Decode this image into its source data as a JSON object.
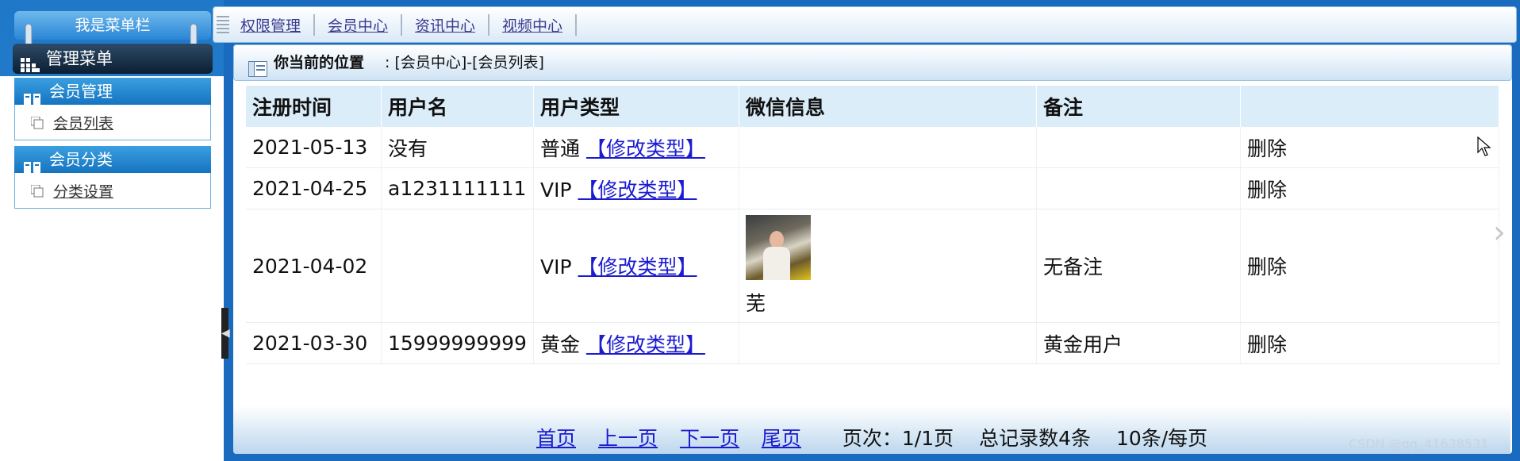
{
  "sidebar": {
    "title": "我是菜单栏",
    "menu_header": "管理菜单",
    "groups": [
      {
        "label": "会员管理",
        "items": [
          {
            "label": "会员列表"
          }
        ]
      },
      {
        "label": "会员分类",
        "items": [
          {
            "label": "分类设置"
          }
        ]
      }
    ]
  },
  "topnav": {
    "links": [
      "权限管理",
      "会员中心",
      "资讯中心",
      "视频中心"
    ]
  },
  "location": {
    "label": "你当前的位置",
    "value": ": [会员中心]-[会员列表]"
  },
  "table": {
    "headers": [
      "注册时间",
      "用户名",
      "用户类型",
      "微信信息",
      "备注",
      ""
    ],
    "rows": [
      {
        "date": "2021-05-13",
        "username": "没有",
        "type": "普通",
        "type_action": "【修改类型】",
        "wechat_name": "",
        "note": "",
        "action": "删除"
      },
      {
        "date": "2021-04-25",
        "username": "a1231111111",
        "type": "VIP",
        "type_action": "【修改类型】",
        "wechat_name": "",
        "note": "",
        "action": "删除"
      },
      {
        "date": "2021-04-02",
        "username": "",
        "type": "VIP",
        "type_action": "【修改类型】",
        "wechat_name": "芜",
        "note": "无备注",
        "action": "删除"
      },
      {
        "date": "2021-03-30",
        "username": "15999999999",
        "type": "黄金",
        "type_action": "【修改类型】",
        "wechat_name": "",
        "note": "黄金用户",
        "action": "删除"
      }
    ]
  },
  "pager": {
    "first": "首页",
    "prev": "上一页",
    "next": "下一页",
    "last": "尾页",
    "page_info": "页次：1/1页",
    "total_info": "总记录数4条",
    "per_page": "10条/每页"
  },
  "watermark": "CSDN @qq_41638531",
  "colors": {
    "sidebar_blue": "#1f78c8",
    "link_blue": "#1b1bd0",
    "header_bg": "#dcedfa"
  }
}
